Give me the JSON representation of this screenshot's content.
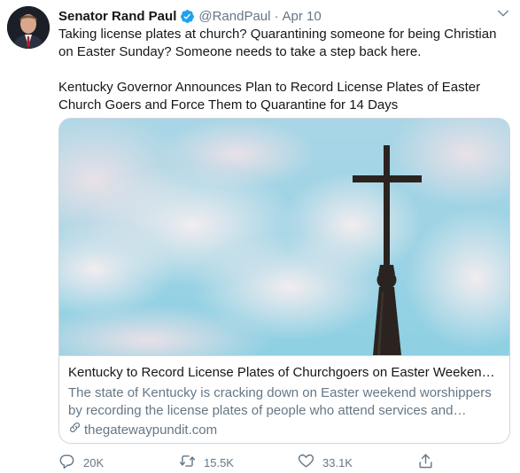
{
  "author": {
    "name": "Senator Rand Paul",
    "handle": "@RandPaul",
    "separator": "·",
    "date": "Apr 10"
  },
  "tweet": {
    "text_line1": "Taking license plates at church? Quarantining someone for being Christian on Easter Sunday? Someone needs to take a step back here.",
    "text_line2": "Kentucky Governor Announces Plan to Record License Plates of Easter Church Goers and Force Them to Quarantine for 14 Days"
  },
  "card": {
    "title": "Kentucky to Record License Plates of Churchgoers on Easter Weekend a...",
    "description": "The state of Kentucky is cracking down on Easter weekend worshippers by recording the license plates of people who attend services and forcin...",
    "domain": "thegatewaypundit.com",
    "image_icon": "church-steeple-cross-image"
  },
  "actions": {
    "reply_count": "20K",
    "retweet_count": "15.5K",
    "like_count": "33.1K"
  },
  "icons": {
    "verified": "verified-badge-icon",
    "caret": "chevron-down-icon",
    "link": "link-icon",
    "reply": "reply-icon",
    "retweet": "retweet-icon",
    "like": "heart-icon",
    "share": "share-icon"
  },
  "colors": {
    "verified": "#1da1f2",
    "secondary_text": "#657786",
    "primary_text": "#14171a",
    "border": "#ccd6dd"
  }
}
